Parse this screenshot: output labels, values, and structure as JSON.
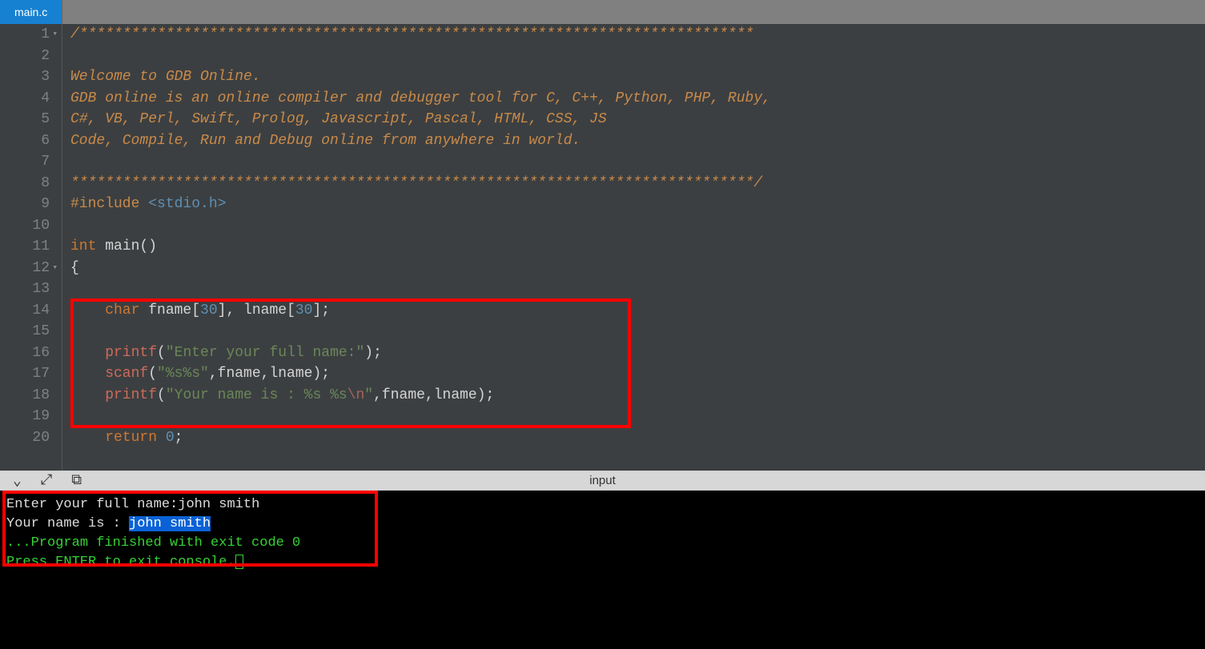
{
  "tab": {
    "filename": "main.c"
  },
  "editor": {
    "lines": {
      "l1_stars": "/******************************************************************************",
      "l2": "",
      "l3": "Welcome to GDB Online.",
      "l4": "GDB online is an online compiler and debugger tool for C, C++, Python, PHP, Ruby, ",
      "l5": "C#, VB, Perl, Swift, Prolog, Javascript, Pascal, HTML, CSS, JS",
      "l6": "Code, Compile, Run and Debug online from anywhere in world.",
      "l7": "",
      "l8_stars": "*******************************************************************************/",
      "l9_include": "#include",
      "l9_header": " <stdio.h>",
      "l10": "",
      "l11_int": "int",
      "l11_rest": " main()",
      "l12": "{",
      "l13": "",
      "l14_char": "    char",
      "l14_a": " fname[",
      "l14_n1": "30",
      "l14_b": "], lname[",
      "l14_n2": "30",
      "l14_c": "];",
      "l15": "    ",
      "l16_fn": "    printf",
      "l16_a": "(",
      "l16_str": "\"Enter your full name:\"",
      "l16_b": ");",
      "l17_fn": "    scanf",
      "l17_a": "(",
      "l17_str": "\"%s%s\"",
      "l17_b": ",fname,lname);",
      "l18_fn": "    printf",
      "l18_a": "(",
      "l18_str_a": "\"Your name is : %s %s",
      "l18_esc": "\\n",
      "l18_str_b": "\"",
      "l18_b": ",fname,lname);",
      "l19": "    ",
      "l20_ret": "    return",
      "l20_a": " ",
      "l20_n": "0",
      "l20_b": ";"
    },
    "line_numbers": [
      "1",
      "2",
      "3",
      "4",
      "5",
      "6",
      "7",
      "8",
      "9",
      "10",
      "11",
      "12",
      "13",
      "14",
      "15",
      "16",
      "17",
      "18",
      "19",
      "20"
    ]
  },
  "toolbar": {
    "input_label": "input"
  },
  "console": {
    "line1_a": "Enter your full name:",
    "line1_b": "john smith",
    "line2_a": "Your name is : ",
    "line2_sel": "john smith",
    "blank": "",
    "line3": "...Program finished with exit code 0",
    "line4": "Press ENTER to exit console."
  }
}
